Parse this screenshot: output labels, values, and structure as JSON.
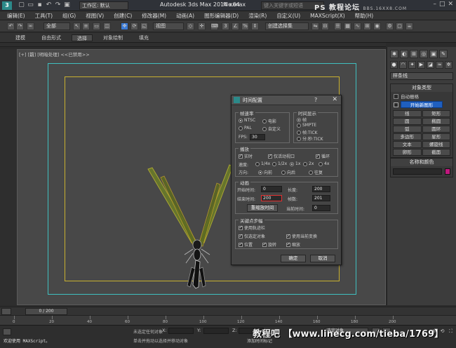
{
  "titlebar": {
    "workspace_label": "工作区: 默认",
    "app_title": "Autodesk 3ds Max  2014 x64",
    "file_name": "file.max",
    "search_placeholder": "键入关键字或短语",
    "watermark": "PS 教程论坛",
    "watermark_url": "BBS.16XX8.COM"
  },
  "menubar": {
    "items": [
      "编辑(E)",
      "工具(T)",
      "组(G)",
      "视图(V)",
      "创建(C)",
      "修改器(M)",
      "动画(A)",
      "图形编辑器(D)",
      "渲染(R)",
      "自定义(U)",
      "MAXScript(X)",
      "帮助(H)"
    ]
  },
  "toolbar": {
    "filter_label": "全部",
    "view_label": "视图",
    "selset_label": "创建选择集"
  },
  "ribbon": {
    "tabs": [
      "建模",
      "自由形式",
      "选择",
      "对象绘制",
      "填充"
    ],
    "active": "选择"
  },
  "viewport": {
    "label_bracket": "[+] [",
    "label_view": "前",
    "label_shade": "] [明暗处理] <<已禁用>>"
  },
  "cmdpanel": {
    "category": "样条线",
    "object_type_title": "对象类型",
    "autogrid_label": "自动栅格",
    "start_new_shape": "开始新图形",
    "shape_buttons": [
      "线",
      "矩形",
      "圆",
      "椭圆",
      "弧",
      "圆环",
      "多边形",
      "星形",
      "文本",
      "螺旋线",
      "卵形",
      "截面"
    ],
    "name_color_title": "名称和颜色",
    "color": "#c0187e"
  },
  "dialog": {
    "title": "时间配置",
    "help": "?",
    "frame_rate": {
      "title": "帧速率",
      "options": [
        "NTSC",
        "电影",
        "PAL",
        "自定义"
      ],
      "selected": "NTSC",
      "fps_label": "FPS:",
      "fps_value": "30"
    },
    "time_display": {
      "title": "时间显示",
      "options": [
        "帧",
        "SMPTE",
        "帧:TICK",
        "分:秒:TICK"
      ],
      "selected": "帧"
    },
    "playback": {
      "title": "播放",
      "realtime": "实时",
      "active_vp_only": "仅活动视口",
      "loop": "循环",
      "speed_label": "速度:",
      "speeds": [
        "1/4x",
        "1/2x",
        "1x",
        "2x",
        "4x"
      ],
      "speed_selected": "1x",
      "direction_label": "方向:",
      "directions": [
        "向前",
        "向后",
        "往复"
      ],
      "direction_selected": "向前"
    },
    "animation": {
      "title": "动画",
      "start_label": "开始时间:",
      "start_value": "0",
      "length_label": "长度:",
      "length_value": "200",
      "end_label": "结束时间:",
      "end_value": "200",
      "frames_label": "帧数:",
      "frames_value": "201",
      "rescale_label": "重缩放时间",
      "current_label": "当前时间:",
      "current_value": "0"
    },
    "key_steps": {
      "title": "关键点步幅",
      "use_trackbar": "使用轨迹栏",
      "selected_only": "仅选定对象",
      "use_current_transform": "使用当前变换",
      "position": "位置",
      "rotation": "旋转",
      "scale": "缩放"
    },
    "ok": "确定",
    "cancel": "取消"
  },
  "timeline": {
    "slider_label": "0 / 200",
    "ticks": [
      "0",
      "20",
      "40",
      "60",
      "80",
      "100",
      "120",
      "140",
      "160",
      "180",
      "200"
    ]
  },
  "statusbar": {
    "maxscript": "欢迎使用 MAXScript。",
    "msg1": "未选定任何对象",
    "msg2": "单击并拖动以选择并移动对象",
    "x_label": "X:",
    "y_label": "Y:",
    "z_label": "Z:",
    "add_time_tag": "添加时间标记",
    "sel_filter": "选定对象",
    "watermark": "教程吧 【www.linecg.com/tieba/1769】"
  }
}
